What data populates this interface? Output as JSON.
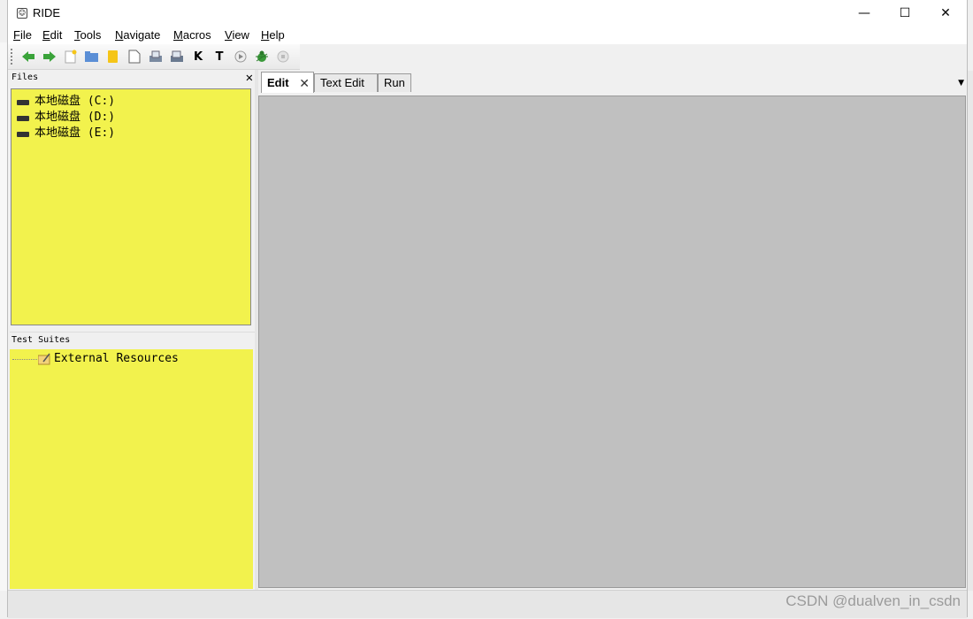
{
  "window": {
    "title": "RIDE",
    "icon": "ride-app-icon",
    "controls": {
      "minimize": "—",
      "maximize": "☐",
      "close": "✕"
    }
  },
  "menubar": {
    "items": [
      {
        "label": "File"
      },
      {
        "label": "Edit"
      },
      {
        "label": "Tools"
      },
      {
        "label": "Navigate"
      },
      {
        "label": "Macros"
      },
      {
        "label": "View"
      },
      {
        "label": "Help"
      }
    ]
  },
  "toolbar": {
    "buttons": [
      "back-arrow-icon",
      "forward-arrow-icon",
      "new-project-icon",
      "open-folder-icon",
      "open-directory-icon",
      "new-file-icon",
      "save-icon",
      "save-all-icon",
      "keyword-search-icon",
      "test-search-icon",
      "run-icon",
      "debug-bug-icon",
      "stop-icon"
    ],
    "keyword_label": "K",
    "test_label": "T"
  },
  "files_pane": {
    "title": "Files",
    "close_glyph": "✕",
    "drives": [
      {
        "label": "本地磁盘 (C:)"
      },
      {
        "label": "本地磁盘 (D:)"
      },
      {
        "label": "本地磁盘 (E:)"
      }
    ]
  },
  "suites_pane": {
    "title": "Test Suites",
    "tree": [
      {
        "label": "External Resources"
      }
    ]
  },
  "notebook": {
    "tabs": [
      {
        "label": "Edit",
        "active": true,
        "close_glyph": "✕"
      },
      {
        "label": "Text Edit",
        "active": false
      },
      {
        "label": "Run",
        "active": false
      }
    ],
    "dropdown_glyph": "▼"
  },
  "watermark": "CSDN @dualven_in_csdn",
  "colors": {
    "tree_background": "#f2f24d",
    "editor_background": "#c0c0c0"
  }
}
